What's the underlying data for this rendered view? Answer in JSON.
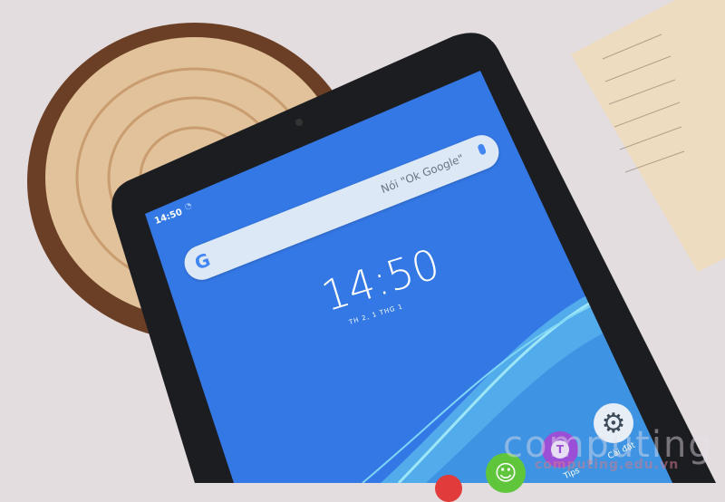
{
  "status_bar": {
    "time": "14:50",
    "wifi_icon": "wifi-icon"
  },
  "search": {
    "logo": "G",
    "placeholder": "Nói \"Ok Google\"",
    "mic_icon": "mic-icon"
  },
  "clock": {
    "time": "14:50",
    "date": "TH 2, 1 THG 1"
  },
  "apps": [
    {
      "label": "Cài đặt",
      "icon": "gear-icon"
    },
    {
      "label": "Tips",
      "icon": "lightbulb-icon"
    },
    {
      "label": "",
      "icon": "smiley-icon"
    }
  ],
  "watermark": {
    "logo": "computing",
    "url": "computing.edu.vn"
  },
  "colors": {
    "screen": "#3478e6",
    "bezel": "#1c1d20",
    "background": "#e3dde0",
    "wood": "#d9b38a"
  }
}
